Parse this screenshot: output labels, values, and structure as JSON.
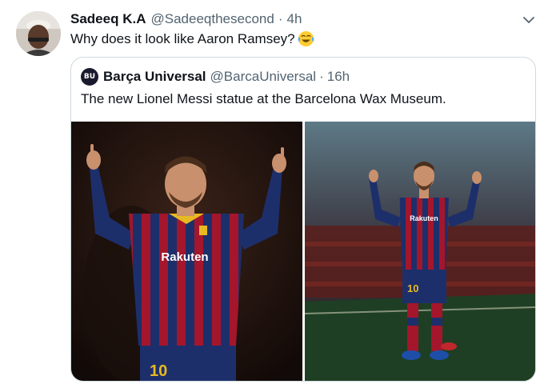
{
  "tweet": {
    "author": {
      "display_name": "Sadeeq K.A",
      "handle": "@Sadeeqthesecond",
      "separator": "·",
      "time": "4h"
    },
    "text": "Why does it look like Aaron Ramsey?",
    "emoji": "face-with-tears-of-joy",
    "menu_icon": "chevron-down-icon"
  },
  "quoted_tweet": {
    "author": {
      "avatar_text": "BU",
      "display_name": "Barça Universal",
      "handle": "@BarcaUniversal",
      "separator": "·",
      "time": "16h"
    },
    "text": "The new Lionel Messi statue at the Barcelona Wax Museum.",
    "photos": [
      {
        "jersey_sponsor": "Rakuten",
        "shorts_number": "10"
      },
      {
        "jersey_sponsor": "Rakuten",
        "shorts_number": "10"
      }
    ]
  },
  "colors": {
    "text_primary": "#0f1419",
    "text_secondary": "#536471",
    "border": "#cfd9de",
    "jersey_red": "#a3162c",
    "jersey_blue": "#1d2f6b"
  }
}
